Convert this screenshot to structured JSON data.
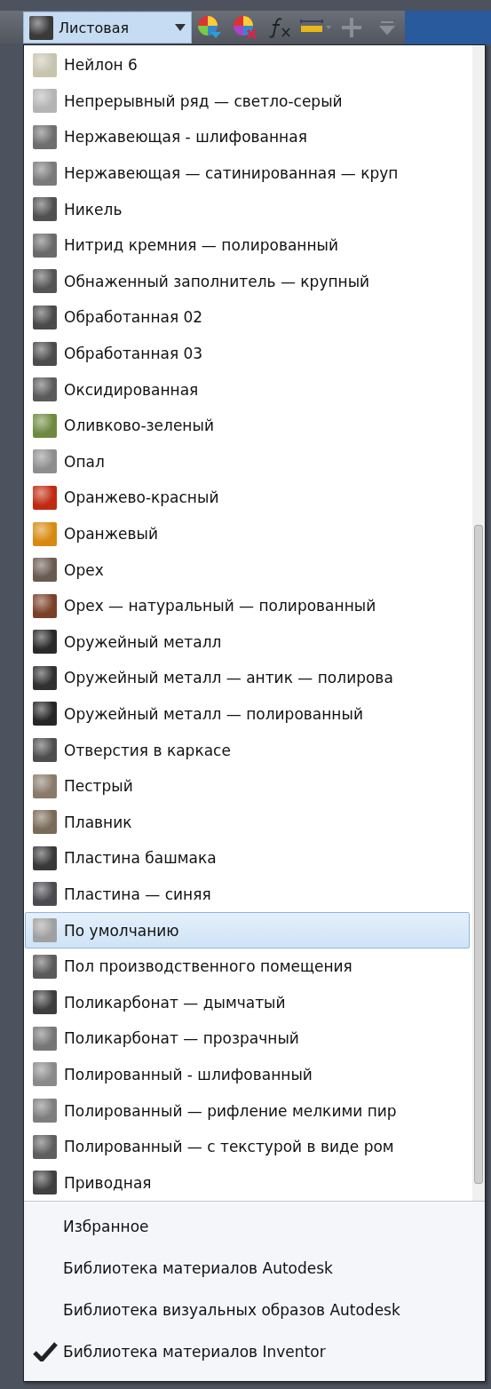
{
  "toolbar": {
    "combo": {
      "value": "Листовая",
      "color": "#3a3a3a"
    },
    "tools": [
      {
        "kind": "color-add"
      },
      {
        "kind": "color-remove"
      },
      {
        "kind": "formula"
      },
      {
        "kind": "measure"
      },
      {
        "kind": "plus"
      },
      {
        "kind": "filter"
      }
    ]
  },
  "materials": [
    {
      "label": "Нейлон 6",
      "color": "#c8c4b0",
      "selected": false
    },
    {
      "label": "Непрерывный ряд — светло-серый",
      "color": "#b4b4b4",
      "selected": false
    },
    {
      "label": "Нержавеющая - шлифованная",
      "color": "#6e6e6e",
      "selected": false
    },
    {
      "label": "Нержавеющая — сатинированная — круп",
      "color": "#7a7a7a",
      "selected": false
    },
    {
      "label": "Никель",
      "color": "#505050",
      "selected": false
    },
    {
      "label": "Нитрид кремния — полированный",
      "color": "#6a6a6a",
      "selected": false
    },
    {
      "label": "Обнаженный заполнитель — крупный",
      "color": "#555555",
      "selected": false
    },
    {
      "label": "Обработанная 02",
      "color": "#4a4a4a",
      "selected": false
    },
    {
      "label": "Обработанная 03",
      "color": "#4c4c4c",
      "selected": false
    },
    {
      "label": "Оксидированная",
      "color": "#5a5a5a",
      "selected": false
    },
    {
      "label": "Оливково-зеленый",
      "color": "#6e8a40",
      "selected": false
    },
    {
      "label": "Опал",
      "color": "#8e8e8e",
      "selected": false
    },
    {
      "label": "Оранжево-красный",
      "color": "#c02a10",
      "selected": false
    },
    {
      "label": "Оранжевый",
      "color": "#d88a10",
      "selected": false
    },
    {
      "label": "Орех",
      "color": "#6a5a50",
      "selected": false
    },
    {
      "label": "Орех — натуральный — полированный",
      "color": "#7a4028",
      "selected": false
    },
    {
      "label": "Оружейный металл",
      "color": "#2a2a2a",
      "selected": false
    },
    {
      "label": "Оружейный металл — антик — полирова",
      "color": "#303030",
      "selected": false
    },
    {
      "label": "Оружейный металл — полированный",
      "color": "#262626",
      "selected": false
    },
    {
      "label": "Отверстия в каркасе",
      "color": "#4e4e4e",
      "selected": false
    },
    {
      "label": "Пестрый",
      "color": "#8a7a6a",
      "selected": false
    },
    {
      "label": "Плавник",
      "color": "#7a6a58",
      "selected": false
    },
    {
      "label": "Пластина башмака",
      "color": "#383838",
      "selected": false
    },
    {
      "label": "Пластина — синяя",
      "color": "#4a4a50",
      "selected": false
    },
    {
      "label": "По умолчанию",
      "color": "#a0a0a0",
      "selected": true
    },
    {
      "label": "Пол производственного помещения",
      "color": "#5a5a5a",
      "selected": false
    },
    {
      "label": "Поликарбонат — дымчатый",
      "color": "#3e3e3e",
      "selected": false
    },
    {
      "label": "Поликарбонат — прозрачный",
      "color": "#767676",
      "selected": false
    },
    {
      "label": "Полированный - шлифованный",
      "color": "#8a8a8a",
      "selected": false
    },
    {
      "label": "Полированный — рифление мелкими пир",
      "color": "#7e7e7e",
      "selected": false
    },
    {
      "label": "Полированный — с текстурой в виде ром",
      "color": "#5e5e5e",
      "selected": false
    },
    {
      "label": "Приводная",
      "color": "#404040",
      "selected": false
    }
  ],
  "libraries": [
    {
      "label": "Избранное",
      "checked": false
    },
    {
      "label": "Библиотека материалов Autodesk",
      "checked": false
    },
    {
      "label": "Библиотека визуальных образов Autodesk",
      "checked": false
    },
    {
      "label": "Библиотека материалов Inventor",
      "checked": true
    }
  ]
}
